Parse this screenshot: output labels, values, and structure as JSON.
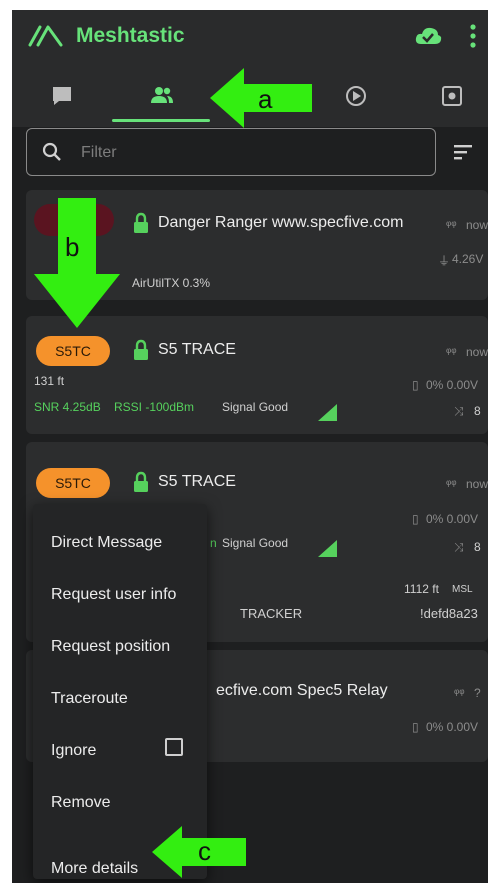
{
  "app": {
    "title": "Meshtastic"
  },
  "tabs": [
    {
      "name": "messages"
    },
    {
      "name": "nodes",
      "selected": true
    },
    {
      "name": "map"
    },
    {
      "name": "settings"
    }
  ],
  "filter": {
    "placeholder": "Filter"
  },
  "nodes": [
    {
      "short_name": "",
      "long_name": "Danger Ranger www.specfive.com",
      "last_heard": "now",
      "battery": "4.26V",
      "air_util": "AirUtilTX 0.3%"
    },
    {
      "short_name": "S5TC",
      "long_name": "S5 TRACE",
      "last_heard": "now",
      "distance": "131 ft",
      "battery": "0% 0.00V",
      "snr": "SNR 4.25dB",
      "rssi": "RSSI -100dBm",
      "signal": "Signal Good",
      "hops": "8"
    },
    {
      "short_name": "S5TC",
      "long_name": "S5 TRACE",
      "last_heard": "now",
      "battery": "0% 0.00V",
      "signal_partial": "n",
      "signal": "Signal Good",
      "hops": "8",
      "altitude": "1112 ft",
      "altitude_unit": "MSL",
      "role": "TRACKER",
      "node_id": "!defd8a23"
    },
    {
      "long_name_partial": "ecfive.com Spec5 Relay",
      "last_heard": "?",
      "battery": "0% 0.00V"
    }
  ],
  "context_menu": {
    "items": [
      "Direct Message",
      "Request user info",
      "Request position",
      "Traceroute",
      "Ignore",
      "Remove",
      "More details"
    ]
  },
  "annotations": {
    "a": "a",
    "b": "b",
    "c": "c"
  },
  "colors": {
    "accent": "#67e27a",
    "chip": "#f5922b",
    "arrow": "#33ee11",
    "background": "#1e1f20"
  }
}
